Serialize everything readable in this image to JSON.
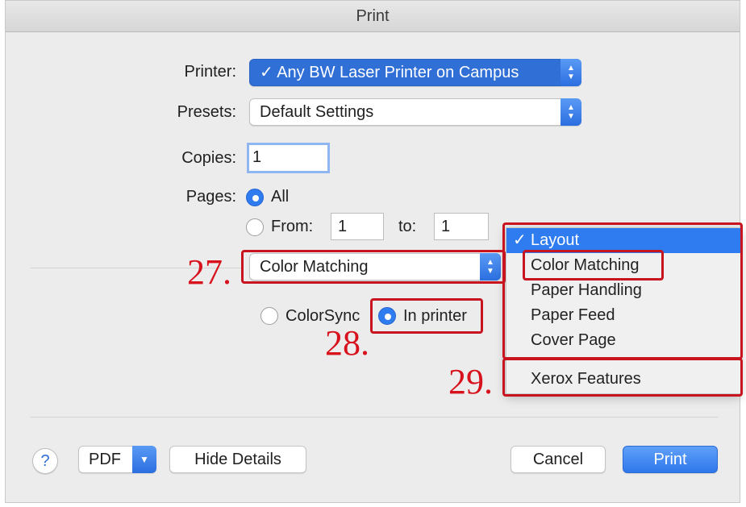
{
  "window": {
    "title": "Print"
  },
  "printer": {
    "label": "Printer:",
    "value": "✓ Any BW Laser Printer on Campus"
  },
  "presets": {
    "label": "Presets:",
    "value": "Default Settings"
  },
  "copies": {
    "label": "Copies:",
    "value": "1"
  },
  "pages": {
    "label": "Pages:",
    "all_label": "All",
    "from_label": "From:",
    "from_value": "1",
    "to_label": "to:",
    "to_value": "1"
  },
  "section_popup": {
    "value": "Color Matching"
  },
  "color_options": {
    "colorsync_label": "ColorSync",
    "in_printer_label": "In printer",
    "selected": "In printer"
  },
  "menu": {
    "items": [
      "Layout",
      "Color Matching",
      "Paper Handling",
      "Paper Feed",
      "Cover Page"
    ],
    "selected": "Layout",
    "extra_item": "Xerox Features",
    "check": "✓"
  },
  "annotations": {
    "a27": "27.",
    "a28": "28.",
    "a29": "29."
  },
  "footer": {
    "help": "?",
    "pdf": "PDF",
    "hide_details": "Hide Details",
    "cancel": "Cancel",
    "print": "Print"
  },
  "colors": {
    "accent": "#2f7cf0",
    "annotation": "#d8121c"
  }
}
